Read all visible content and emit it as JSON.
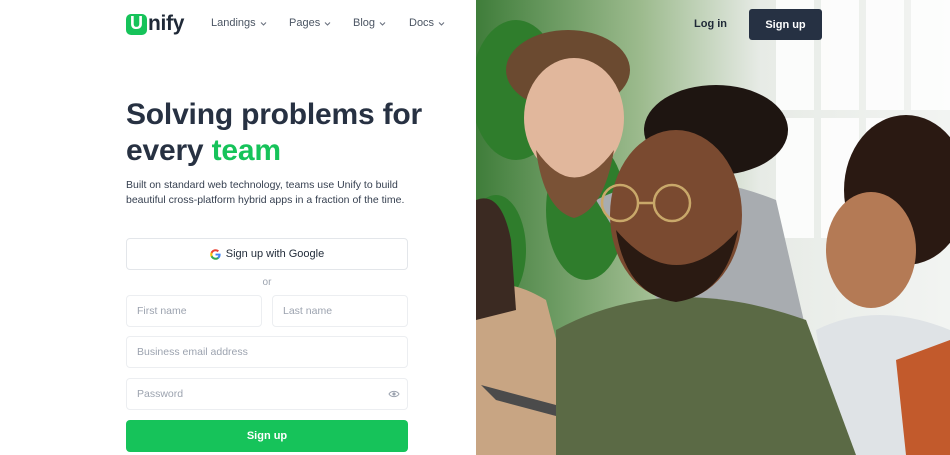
{
  "brand": {
    "logo_letter": "U",
    "logo_rest": "nify",
    "accent_color": "#16c35a",
    "dark_color": "#263143"
  },
  "nav": {
    "items": [
      {
        "label": "Landings",
        "icon": "chevron-down-icon"
      },
      {
        "label": "Pages",
        "icon": "chevron-down-icon"
      },
      {
        "label": "Blog",
        "icon": "chevron-down-icon"
      },
      {
        "label": "Docs",
        "icon": "chevron-down-icon"
      }
    ],
    "login_label": "Log in",
    "signup_label": "Sign up"
  },
  "hero": {
    "headline_line1": "Solving problems for",
    "headline_line2_start": "every",
    "headline_accent": "team",
    "intro": "Built on standard web technology, teams use Unify to build beautiful cross-platform hybrid apps in a fraction of the time."
  },
  "form": {
    "google_label": "Sign up with Google",
    "google_icon": "google-icon",
    "or_label": "or",
    "first_name_placeholder": "First name",
    "last_name_placeholder": "Last name",
    "email_placeholder": "Business email address",
    "password_placeholder": "Password",
    "password_toggle_icon": "eye-icon",
    "submit_label": "Sign up"
  },
  "image": {
    "subject": "team-photo"
  }
}
